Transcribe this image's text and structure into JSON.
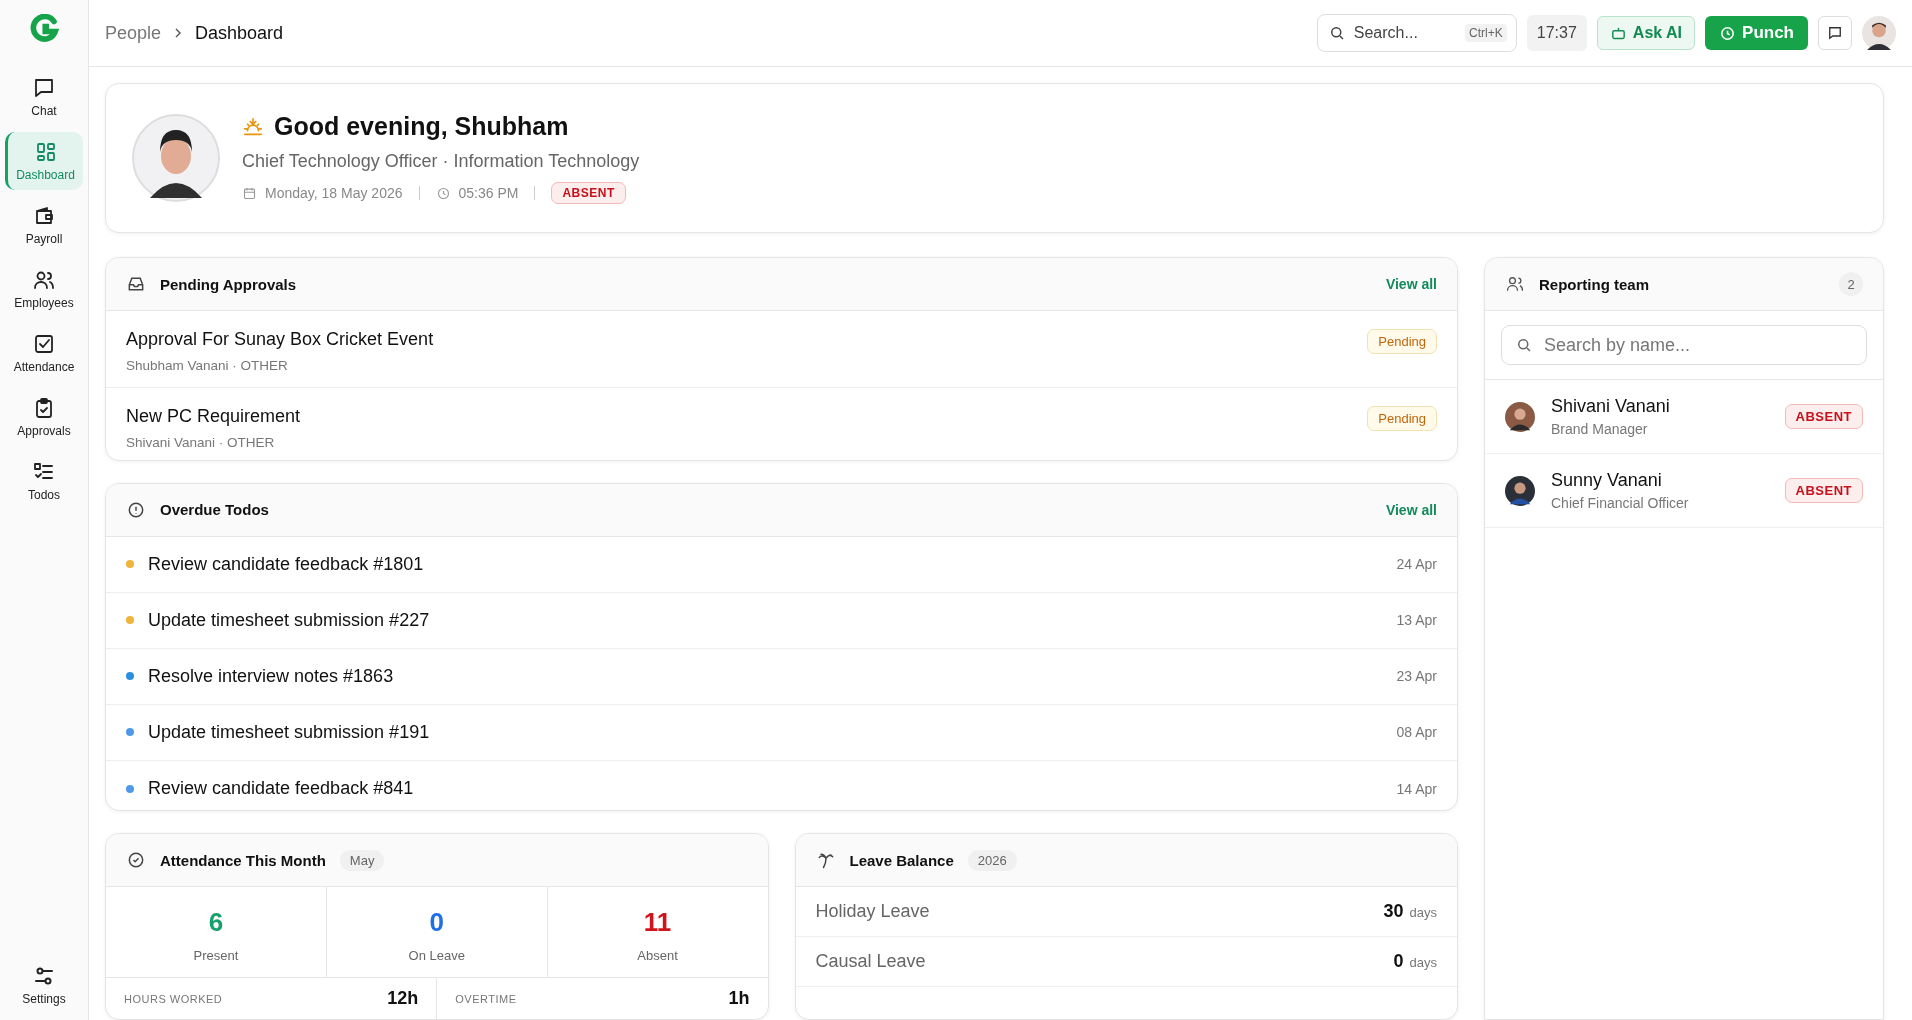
{
  "sidebar": {
    "items": [
      {
        "label": "Chat",
        "selected": false
      },
      {
        "label": "Dashboard",
        "selected": true
      },
      {
        "label": "Payroll",
        "selected": false
      },
      {
        "label": "Employees",
        "selected": false
      },
      {
        "label": "Attendance",
        "selected": false
      },
      {
        "label": "Approvals",
        "selected": false
      },
      {
        "label": "Todos",
        "selected": false
      }
    ],
    "bottom_item": {
      "label": "Settings",
      "selected": false
    }
  },
  "breadcrumb": [
    "People",
    "Dashboard"
  ],
  "topbar": {
    "search_placeholder": "Search...",
    "shortcut": "Ctrl+K",
    "time": "17:37",
    "ask_ai": "Ask AI",
    "punch": "Punch"
  },
  "profile": {
    "greeting": "Good evening, Shubham",
    "role": "Chief Technology Officer · Information Technology",
    "date": "Monday, 18 May 2026",
    "time": "05:36 PM",
    "status": "ABSENT"
  },
  "pending_approvals": {
    "title": "Pending Approvals",
    "view_all": "View all",
    "items": [
      {
        "title": "Approval For Sunay Box Cricket Event",
        "meta": "Shubham Vanani · OTHER",
        "status": "Pending"
      },
      {
        "title": "New PC Requirement",
        "meta": "Shivani Vanani · OTHER",
        "status": "Pending"
      }
    ]
  },
  "overdue_todos": {
    "title": "Overdue Todos",
    "view_all": "View all",
    "items": [
      {
        "title": "Review candidate feedback #1801",
        "date": "24 Apr",
        "color": "#f0b43c"
      },
      {
        "title": "Update timesheet submission #227",
        "date": "13 Apr",
        "color": "#f0b43c"
      },
      {
        "title": "Resolve interview notes #1863",
        "date": "23 Apr",
        "color": "#2b8fe0"
      },
      {
        "title": "Update timesheet submission #191",
        "date": "08 Apr",
        "color": "#4f9ae8"
      },
      {
        "title": "Review candidate feedback #841",
        "date": "14 Apr",
        "color": "#4f9ae8"
      }
    ]
  },
  "attendance": {
    "title": "Attendance This Month",
    "badge": "May",
    "stats": [
      {
        "value": "6",
        "label": "Present",
        "color": "#16a06a"
      },
      {
        "value": "0",
        "label": "On Leave",
        "color": "#1f6fe8"
      },
      {
        "value": "11",
        "label": "Absent",
        "color": "#d0141c"
      }
    ],
    "totals": [
      {
        "label": "HOURS WORKED",
        "value": "12h"
      },
      {
        "label": "OVERTIME",
        "value": "1h"
      }
    ]
  },
  "leave_balance": {
    "title": "Leave Balance",
    "badge": "2026",
    "items": [
      {
        "name": "Holiday Leave",
        "value": "30",
        "unit": "days"
      },
      {
        "name": "Causal Leave",
        "value": "0",
        "unit": "days"
      }
    ]
  },
  "reporting_team": {
    "title": "Reporting team",
    "count": "2",
    "search_placeholder": "Search by name...",
    "members": [
      {
        "name": "Shivani Vanani",
        "role": "Brand Manager",
        "status": "ABSENT"
      },
      {
        "name": "Sunny Vanani",
        "role": "Chief Financial Officer",
        "status": "ABSENT"
      }
    ]
  }
}
